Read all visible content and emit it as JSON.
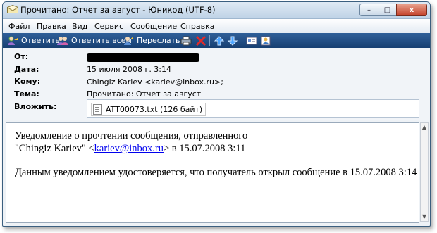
{
  "window": {
    "title": "Прочитано: Отчет за август - Юникод (UTF-8)",
    "controls": {
      "minimize": "–",
      "maximize": "□",
      "close": "x"
    }
  },
  "menu": [
    "Файл",
    "Правка",
    "Вид",
    "Сервис",
    "Сообщение",
    "Справка"
  ],
  "toolbar": {
    "reply": "Ответить",
    "reply_all": "Ответить всем",
    "forward": "Переслать"
  },
  "header": {
    "from_label": "От:",
    "date_label": "Дата:",
    "date_value": "15 июля 2008 г. 3:14",
    "to_label": "Кому:",
    "to_value": "Chingiz Kariev <kariev@inbox.ru>;",
    "subject_label": "Тема:",
    "subject_value": "Прочитано: Отчет за август",
    "attach_label": "Вложить:",
    "attachment": "ATT00073.txt (126 байт)"
  },
  "message": {
    "line1": "Уведомление о прочтении сообщения, отправленного",
    "line2_name": "\"Chingiz Kariev\" <",
    "line2_link": "kariev@inbox.ru",
    "line2_rest": "> в 15.07.2008 3:11",
    "line3": "Данным уведомлением удостоверяется, что получатель открыл сообщение в 15.07.2008 3:14"
  },
  "colors": {
    "toolbar_bg": "#1f4a80",
    "titlebar_bg": "#cfdeed",
    "close_button": "#c4422b",
    "link": "#0000ee"
  }
}
